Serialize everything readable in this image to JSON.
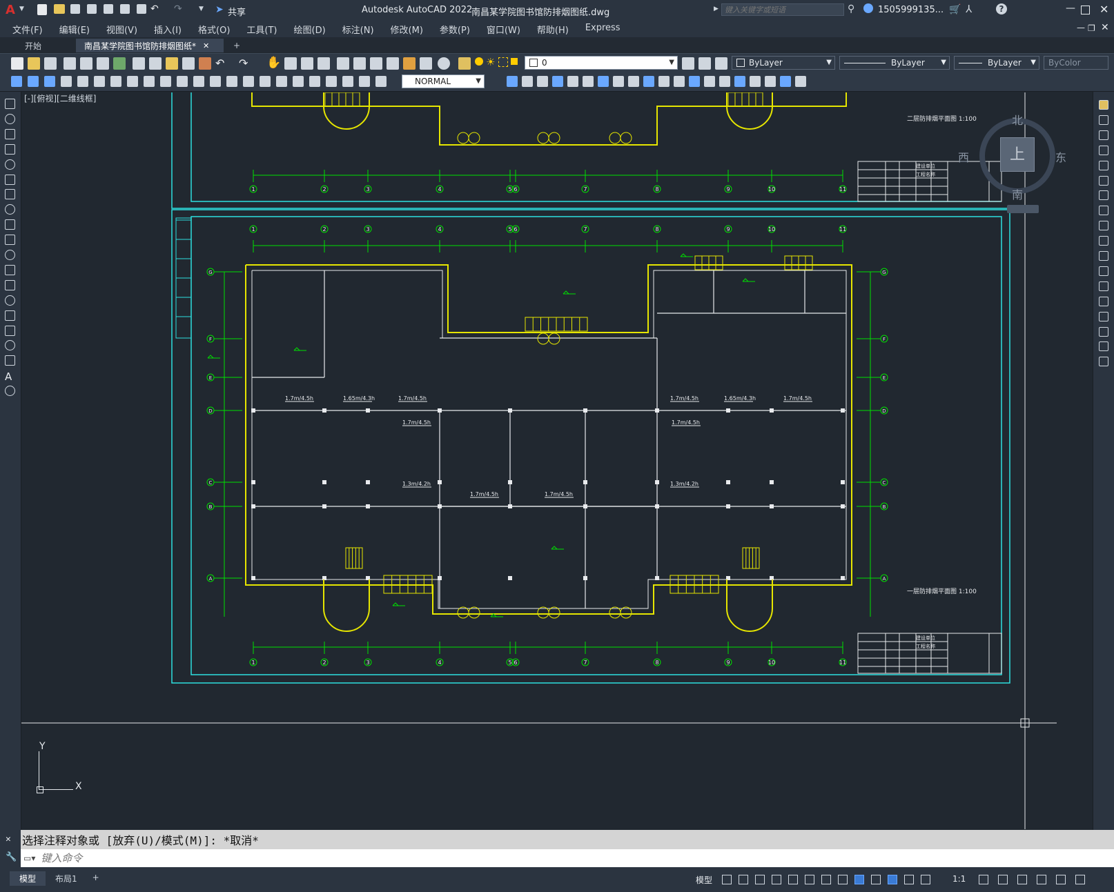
{
  "app": {
    "title": "Autodesk AutoCAD 2022",
    "document": "南昌某学院图书馆防排烟图纸.dwg",
    "share_label": "共享",
    "search_placeholder": "键入关键字或短语",
    "user": "1505999135...",
    "accent": "#d7302e"
  },
  "menu": [
    "文件(F)",
    "编辑(E)",
    "视图(V)",
    "插入(I)",
    "格式(O)",
    "工具(T)",
    "绘图(D)",
    "标注(N)",
    "修改(M)",
    "参数(P)",
    "窗口(W)",
    "帮助(H)",
    "Express"
  ],
  "tabs": {
    "start": "开始",
    "active": "南昌某学院图书馆防排烟图纸*",
    "close": "✕",
    "add": "+"
  },
  "toolbar": {
    "layer": "0",
    "color": "ByLayer",
    "linetype": "ByLayer",
    "lineweight": "ByLayer",
    "plotstyle": "ByColor",
    "textstyle": "NORMAL"
  },
  "viewport": {
    "label": "[-][俯视][二维线框]"
  },
  "viewcube": {
    "north": "北",
    "south": "南",
    "east": "东",
    "west": "西",
    "top": "上"
  },
  "ucs": {
    "x": "X",
    "y": "Y"
  },
  "drawing": {
    "plan_upper_title": "二层防排烟平面图 1:100",
    "plan_lower_title": "一层防排烟平面图 1:100",
    "grid_numbers": [
      "1",
      "2",
      "3",
      "4",
      "5",
      "6",
      "7",
      "8",
      "9",
      "10",
      "11"
    ],
    "grid_letters": [
      "G",
      "F",
      "E",
      "D",
      "C",
      "B",
      "A"
    ],
    "smoke_labels": [
      "1.7m/4.5h",
      "1.65m/4.3h",
      "1.7m/4.5h",
      "1.7m/4.5h",
      "1.65m/4.3h",
      "1.7m/4.5h",
      "1.7m/4.5h",
      "1.7m/4.5h",
      "1.3m/4.2h",
      "1.7m/4.5h",
      "1.7m/4.5h",
      "1.3m/4.2h"
    ],
    "title_block_upper": {
      "row1": "建设单位",
      "row2": "工程名称"
    },
    "title_block_lower": {
      "row1": "建设单位",
      "row2": "工程名称"
    }
  },
  "command": {
    "history": "选择注释对象或 [放弃(U)/模式(M)]: *取消*",
    "placeholder": "键入命令"
  },
  "status": {
    "model_tab": "模型",
    "layout_tab": "布局1",
    "add": "+",
    "model_label": "模型",
    "scale": "1:1"
  }
}
